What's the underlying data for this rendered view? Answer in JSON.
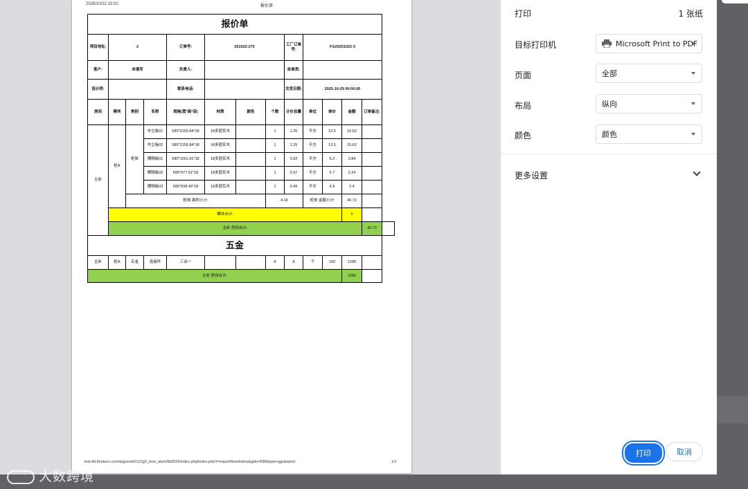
{
  "page": {
    "header_datetime": "2025/10/22 15:02",
    "header_title": "报价单",
    "footer_url": "test-lbl.thinkers.com/wyjoeshi0122g2_mini_alum/lbl2025/index.php/index.php?r=reportNew/index&gids=838&type=gguireport",
    "footer_page": "1/1"
  },
  "quote": {
    "title": "报价单",
    "labels": {
      "project_addr": "项目地址:",
      "order_no": "订单号:",
      "factory_order_no": "工厂订单号:",
      "customer": "客户:",
      "owner": "负责人:",
      "dismantle_order": "拆单员:",
      "designer": "设计师:",
      "contact_phone": "联系电话:",
      "delivery_date": "交货日期:"
    },
    "values": {
      "project_addr": "2",
      "order_no": "251022-270",
      "factory_order_no": "FG20251022-3",
      "customer": "未填写",
      "owner": "",
      "dismantle_order": "",
      "designer": "",
      "contact_phone": "",
      "delivery_date": "2025-10-29 00:00:00"
    },
    "columns": [
      "房间",
      "模块",
      "类别",
      "名称",
      "规格(宽*高*深)",
      "材质",
      "颜色",
      "个数",
      "计价总量",
      "单位",
      "单价",
      "金额",
      "订单备注:"
    ],
    "room": "主卧",
    "module": "柜A",
    "category": "柜体",
    "rows": [
      {
        "name": "中立板01",
        "spec": "580*2155.84*18",
        "material": "18多层实木",
        "color": "",
        "qty": "1",
        "total": "1.25",
        "unit": "平方",
        "price": "12.5",
        "amount": "15.62"
      },
      {
        "name": "中立板02",
        "spec": "580*2155.84*18",
        "material": "18多层实木",
        "color": "",
        "qty": "1",
        "total": "1.25",
        "unit": "平方",
        "price": "12.5",
        "amount": "15.62"
      },
      {
        "name": "横隔板01",
        "spec": "580*1061.81*18",
        "material": "18多层实木",
        "color": "",
        "qty": "1",
        "total": "0.62",
        "unit": "平方",
        "price": "6.2",
        "amount": "3.84"
      },
      {
        "name": "横隔板02",
        "spec": "580*977.61*18",
        "material": "18多层实木",
        "color": "",
        "qty": "1",
        "total": "0.57",
        "unit": "平方",
        "price": "5.7",
        "amount": "3.24"
      },
      {
        "name": "横隔板03",
        "spec": "580*838.46*18",
        "material": "18多层实木",
        "color": "",
        "qty": "1",
        "total": "0.49",
        "unit": "平方",
        "price": "4.9",
        "amount": "2.4"
      }
    ],
    "subtotal": {
      "area_label": "柜体 面积小计:",
      "area_value": "4.18",
      "amount_label": "柜体 金额小计:",
      "amount_value": "40.72"
    },
    "module_total": {
      "label": "模块合计:",
      "value": "0"
    },
    "room_total": {
      "label": "主卧 房间合计:",
      "value": "40.72"
    },
    "hardware_title": "五金",
    "hardware_row": {
      "room": "主卧",
      "module": "柜A",
      "category": "五金",
      "name": "连接件",
      "spec": "三合一",
      "material": "",
      "color": "",
      "qty": "8",
      "total": "8",
      "unit": "个",
      "price": "160",
      "amount": "1280"
    },
    "hardware_total": {
      "label": "主卧 房间合计:",
      "value": "1280"
    }
  },
  "sidebar": {
    "title": "打印",
    "sheet_count": "1 张纸",
    "destination_label": "目标打印机",
    "destination_value": "Microsoft Print to PDF",
    "pages_label": "页面",
    "pages_value": "全部",
    "layout_label": "布局",
    "layout_value": "纵向",
    "color_label": "颜色",
    "color_value": "颜色",
    "more_settings": "更多设置",
    "print_button": "打印",
    "cancel_button": "取消",
    "accent": "#1a73e8"
  },
  "watermark": {
    "text": "大数跨境"
  }
}
